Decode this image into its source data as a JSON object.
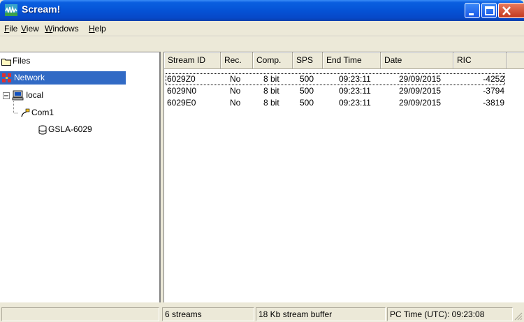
{
  "window": {
    "title": "Scream!"
  },
  "menu": [
    {
      "label": "File",
      "accel": "F",
      "rest": "ile"
    },
    {
      "label": "View",
      "accel": "V",
      "rest": "iew"
    },
    {
      "label": "Windows",
      "accel": "W",
      "rest": "indows"
    },
    {
      "label": "Help",
      "accel": "H",
      "rest": "elp"
    }
  ],
  "tree": {
    "files": "Files",
    "network": "Network",
    "local": "local",
    "com1": "Com1",
    "gsla": "GSLA-6029"
  },
  "table": {
    "columns": [
      "Stream ID",
      "Rec.",
      "Comp.",
      "SPS",
      "End Time",
      "Date",
      "RIC"
    ],
    "rows": [
      [
        "6029Z0",
        "No",
        "8 bit",
        "500",
        "09:23:11",
        "29/09/2015",
        "-4252"
      ],
      [
        "6029N0",
        "No",
        "8 bit",
        "500",
        "09:23:11",
        "29/09/2015",
        "-3794"
      ],
      [
        "6029E0",
        "No",
        "8 bit",
        "500",
        "09:23:11",
        "29/09/2015",
        "-3819"
      ]
    ]
  },
  "status": {
    "streams": "6 streams",
    "buffer": "18 Kb stream buffer",
    "pc_time": "PC Time (UTC):  09:23:08"
  },
  "colors": {
    "title_blue": "#0553d6",
    "selection": "#316ac5",
    "face": "#ece9d8"
  }
}
